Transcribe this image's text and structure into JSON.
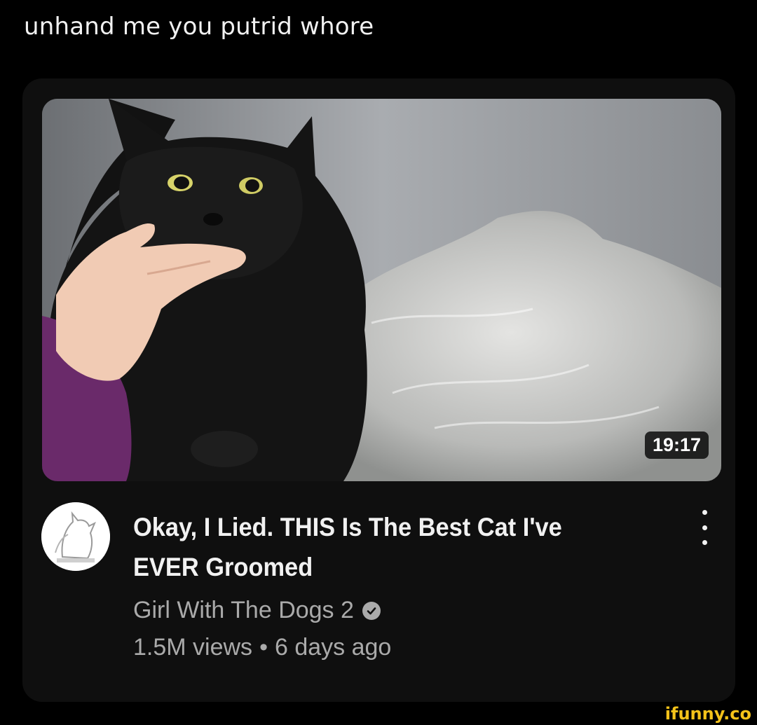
{
  "post": {
    "caption": "unhand me you putrid whore"
  },
  "video": {
    "duration": "19:17",
    "title": "Okay, I Lied. THIS Is The Best Cat I've EVER Groomed",
    "channel": "Girl With The Dogs 2",
    "views": "1.5M views",
    "separator": "•",
    "age": "6 days ago",
    "icons": {
      "verified": "verified-check-icon",
      "more": "more-vert-icon"
    }
  },
  "watermark": {
    "text": "ifunny.co",
    "color": "#f5c31a"
  },
  "colors": {
    "background": "#000000",
    "card": "#0f0f0f",
    "title_text": "#f1f1f1",
    "secondary_text": "#aaaaaa"
  }
}
